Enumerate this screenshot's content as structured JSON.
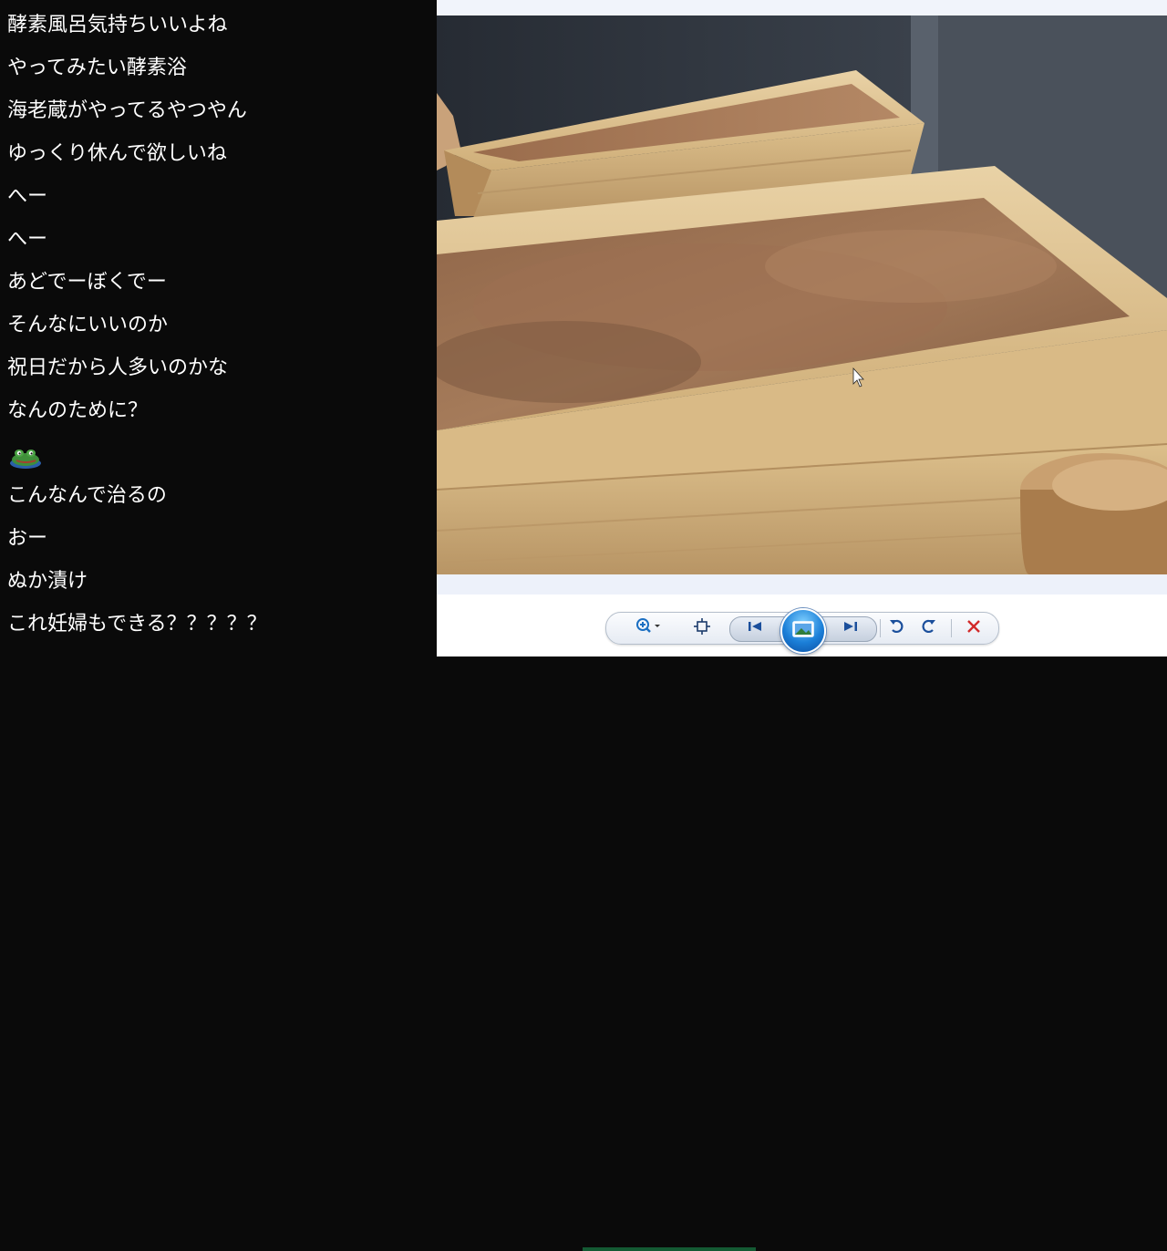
{
  "chat": {
    "messages": [
      {
        "type": "text",
        "text": "酵素風呂気持ちいいよね"
      },
      {
        "type": "text",
        "text": "やってみたい酵素浴"
      },
      {
        "type": "text",
        "text": "海老蔵がやってるやつやん"
      },
      {
        "type": "text",
        "text": "ゆっくり休んで欲しいね"
      },
      {
        "type": "text",
        "text": "へー"
      },
      {
        "type": "text",
        "text": "へー"
      },
      {
        "type": "text",
        "text": "あどでーぼくでー"
      },
      {
        "type": "text",
        "text": "そんなにいいのか"
      },
      {
        "type": "text",
        "text": "祝日だから人多いのかな"
      },
      {
        "type": "text",
        "text": "なんのために？"
      },
      {
        "type": "emote",
        "icon": "frog-emote-icon"
      },
      {
        "type": "text",
        "text": "こんなんで治るの"
      },
      {
        "type": "text",
        "text": "おー"
      },
      {
        "type": "text",
        "text": "ぬか漬け"
      },
      {
        "type": "text",
        "text": "これ妊婦もできる？？？？？"
      }
    ]
  },
  "viewer": {
    "photo": {
      "icon": "enzyme-bath-photo"
    },
    "toolbar": {
      "buttons": [
        {
          "name": "zoom-button",
          "icon": "magnifier-icon"
        },
        {
          "name": "actual-size-button",
          "icon": "fit-window-icon"
        },
        {
          "name": "previous-button",
          "icon": "skip-previous-icon"
        },
        {
          "name": "slideshow-button",
          "icon": "slideshow-icon"
        },
        {
          "name": "next-button",
          "icon": "skip-next-icon"
        },
        {
          "name": "rotate-left-button",
          "icon": "rotate-ccw-icon"
        },
        {
          "name": "rotate-right-button",
          "icon": "rotate-cw-icon"
        },
        {
          "name": "delete-button",
          "icon": "close-icon"
        }
      ]
    }
  },
  "colors": {
    "chat_background": "#0a0a0a",
    "chat_text": "#ffffff",
    "viewer_background": "#f1f4fb",
    "delete_red": "#d22a2a",
    "accent_blue": "#1b6fc2"
  }
}
